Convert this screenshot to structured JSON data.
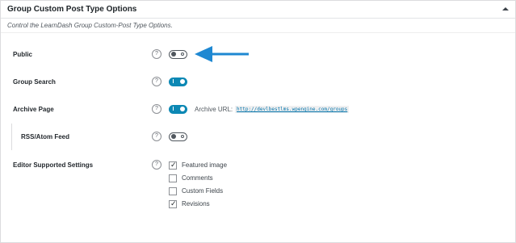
{
  "panel": {
    "title": "Group Custom Post Type Options",
    "description": "Control the LearnDash Group Custom-Post Type Options.",
    "collapse_icon": "triangle-up-icon"
  },
  "rows": {
    "public": {
      "label": "Public",
      "help": "?",
      "toggle_state": "off"
    },
    "group_search": {
      "label": "Group Search",
      "help": "?",
      "toggle_state": "on"
    },
    "archive_page": {
      "label": "Archive Page",
      "help": "?",
      "toggle_state": "on",
      "url_label": "Archive URL:",
      "url": "http://devlbestlms.wpengine.com/groups"
    },
    "rss_feed": {
      "label": "RSS/Atom Feed",
      "help": "?",
      "toggle_state": "off"
    },
    "editor_settings": {
      "label": "Editor Supported Settings",
      "help": "?",
      "options": [
        {
          "label": "Featured image",
          "checked": true,
          "mark": "✓"
        },
        {
          "label": "Comments",
          "checked": false,
          "mark": ""
        },
        {
          "label": "Custom Fields",
          "checked": false,
          "mark": ""
        },
        {
          "label": "Revisions",
          "checked": true,
          "mark": "✓"
        }
      ]
    }
  },
  "annotation": {
    "icon": "arrow-left-icon",
    "color": "#1e88d2"
  },
  "colors": {
    "toggle_on": "#0c88b4",
    "link": "#0073aa"
  }
}
